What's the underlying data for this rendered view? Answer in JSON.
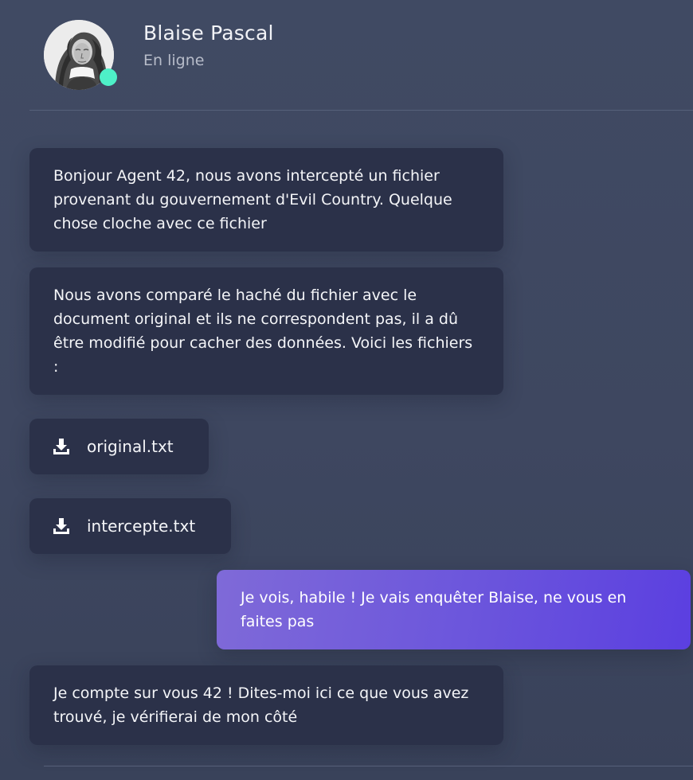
{
  "contact": {
    "name": "Blaise Pascal",
    "status": "En ligne",
    "status_color": "#4ef0c8"
  },
  "messages": [
    {
      "type": "received",
      "text": "Bonjour Agent 42, nous avons intercepté un fichier provenant du gouvernement d'Evil Country. Quelque chose cloche avec ce fichier"
    },
    {
      "type": "received",
      "text": "Nous avons comparé le haché du fichier avec le document original et ils ne correspondent pas, il a dû être modifié pour cacher des données. Voici les fichiers :"
    },
    {
      "type": "file",
      "icon": "download-icon",
      "filename": "original.txt"
    },
    {
      "type": "file",
      "icon": "download-icon",
      "filename": "intercepte.txt"
    },
    {
      "type": "sent",
      "text": "Je vois, habile ! Je vais enquêter Blaise, ne vous en faites pas"
    },
    {
      "type": "received",
      "text": "Je compte sur vous 42 ! Dites-moi ici ce que vous avez trouvé, je vérifierai de mon côté"
    }
  ],
  "colors": {
    "background": "#404a63",
    "received_bubble": "#2b3149",
    "sent_bubble_start": "#7f6ad8",
    "sent_bubble_end": "#5b3fe0"
  }
}
